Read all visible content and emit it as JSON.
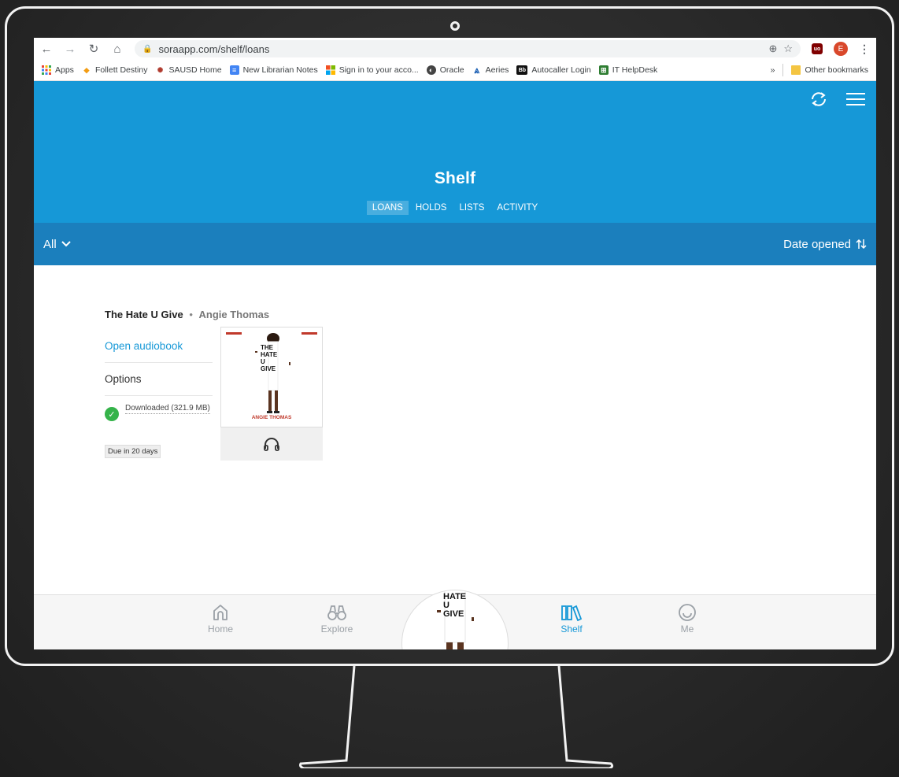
{
  "browser": {
    "url": "soraapp.com/shelf/loans",
    "profile_initial": "E",
    "bookmarks": [
      {
        "label": "Apps",
        "icon": "apps-grid-icon"
      },
      {
        "label": "Follett Destiny",
        "icon": "follett-icon"
      },
      {
        "label": "SAUSD Home",
        "icon": "sausd-icon"
      },
      {
        "label": "New Librarian Notes",
        "icon": "docs-icon"
      },
      {
        "label": "Sign in to your acco...",
        "icon": "microsoft-icon"
      },
      {
        "label": "Oracle",
        "icon": "oracle-icon"
      },
      {
        "label": "Aeries",
        "icon": "aeries-icon"
      },
      {
        "label": "Autocaller Login",
        "icon": "blackboard-icon",
        "badge": "Bb"
      },
      {
        "label": "IT HelpDesk",
        "icon": "helpdesk-icon"
      }
    ],
    "more_bookmarks": "»",
    "other_bookmarks": "Other bookmarks"
  },
  "app": {
    "title": "Shelf",
    "tabs": [
      {
        "label": "LOANS",
        "active": true
      },
      {
        "label": "HOLDS",
        "active": false
      },
      {
        "label": "LISTS",
        "active": false
      },
      {
        "label": "ACTIVITY",
        "active": false
      }
    ],
    "filter": "All",
    "sort": "Date opened"
  },
  "loan": {
    "title": "The Hate U Give",
    "separator": "•",
    "author": "Angie Thomas",
    "open_label": "Open audiobook",
    "options_label": "Options",
    "download_status": "Downloaded (321.9 MB)",
    "due": "Due in 20 days",
    "cover": {
      "words": [
        "THE",
        "HATE",
        "U",
        "GIVE"
      ],
      "author_line": "ANGIE THOMAS"
    }
  },
  "bottom_nav": [
    {
      "label": "Home",
      "icon": "home-icon",
      "active": false
    },
    {
      "label": "Explore",
      "icon": "binoculars-icon",
      "active": false
    },
    {
      "label": "Shelf",
      "icon": "shelf-books-icon",
      "active": true
    },
    {
      "label": "Me",
      "icon": "smiley-icon",
      "active": false
    }
  ],
  "colors": {
    "accent": "#1698d7",
    "filter_bar": "#1b7fbd",
    "success": "#35b34a"
  }
}
